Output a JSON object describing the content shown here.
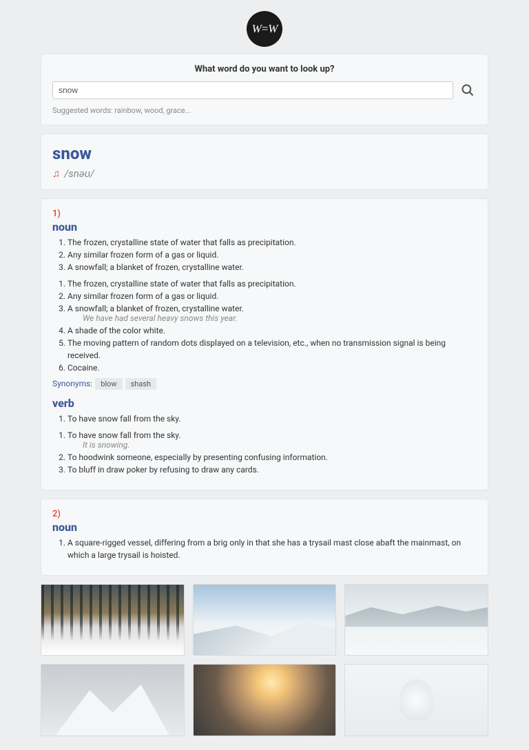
{
  "logo_text": "W=W",
  "search": {
    "title": "What word do you want to look up?",
    "value": "snow",
    "suggest": "Suggested words: rainbow, wood, grace..."
  },
  "word": {
    "title": "snow",
    "phonetic": "/snəʊ/"
  },
  "entries": [
    {
      "num": "1)",
      "parts": [
        {
          "pos": "noun",
          "defs": [
            {
              "text": "The frozen, crystalline state of water that falls as precipitation."
            },
            {
              "text": "Any similar frozen form of a gas or liquid."
            },
            {
              "text": "A snowfall; a blanket of frozen, crystalline water.",
              "example": "We have had several heavy snows this year."
            },
            {
              "text": "A shade of the color white."
            },
            {
              "text": "The moving pattern of random dots displayed on a television, etc., when no transmission signal is being received."
            },
            {
              "text": "Cocaine."
            }
          ],
          "synonyms_label": "Synonyms:",
          "synonyms": [
            "blow",
            "shash"
          ]
        },
        {
          "pos": "verb",
          "defs": [
            {
              "text": "To have snow fall from the sky.",
              "example": "It is snowing."
            },
            {
              "text": "To hoodwink someone, especially by presenting confusing information."
            },
            {
              "text": "To bluff in draw poker by refusing to draw any cards."
            }
          ]
        }
      ]
    },
    {
      "num": "2)",
      "parts": [
        {
          "pos": "noun",
          "defs": [
            {
              "text": "A square-rigged vessel, differing from a brig only in that she has a trysail mast close abaft the mainmast, on which a large trysail is hoisted."
            }
          ]
        }
      ]
    }
  ],
  "images": [
    {
      "alt": "snowy forest road"
    },
    {
      "alt": "snowy mountain skiers"
    },
    {
      "alt": "snowy valley"
    },
    {
      "alt": "snow covered cabins"
    },
    {
      "alt": "sunset over snowy forest"
    },
    {
      "alt": "lone frosted tree"
    }
  ]
}
